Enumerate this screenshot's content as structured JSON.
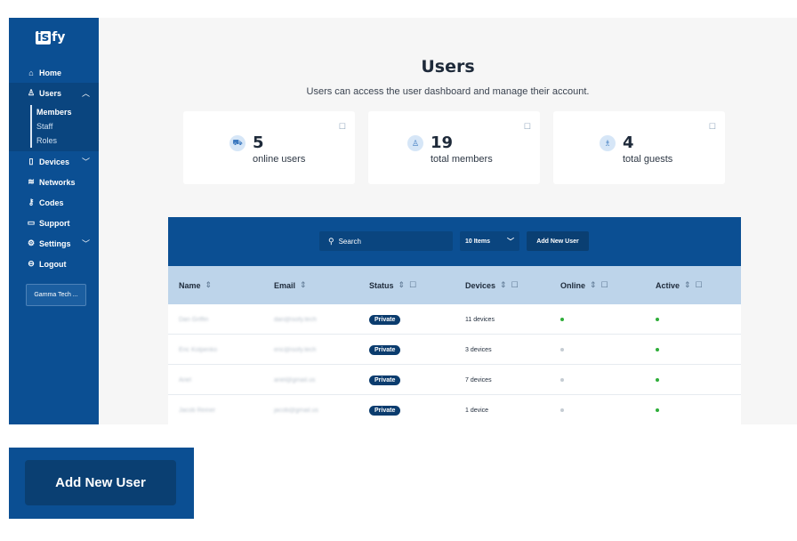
{
  "brand": {
    "logo_left": "is",
    "logo_right": "fy"
  },
  "sidebar": {
    "items": [
      {
        "label": "Home",
        "icon": "home-icon"
      },
      {
        "label": "Users",
        "icon": "user-icon",
        "expanded": true
      },
      {
        "label": "Devices",
        "icon": "device-icon"
      },
      {
        "label": "Networks",
        "icon": "wifi-icon"
      },
      {
        "label": "Codes",
        "icon": "key-icon"
      },
      {
        "label": "Support",
        "icon": "ticket-icon"
      },
      {
        "label": "Settings",
        "icon": "gear-icon"
      },
      {
        "label": "Logout",
        "icon": "logout-icon"
      }
    ],
    "users_sub": [
      "Members",
      "Staff",
      "Roles"
    ],
    "active_sub": "Members",
    "tenant": "Gamma Tech ..."
  },
  "header": {
    "title": "Users",
    "subtitle": "Users can access the user dashboard and manage their account."
  },
  "stats": [
    {
      "value": "5",
      "label": "online users",
      "icon": "car-icon"
    },
    {
      "value": "19",
      "label": "total members",
      "icon": "user-icon"
    },
    {
      "value": "4",
      "label": "total guests",
      "icon": "guest-icon"
    }
  ],
  "toolbar": {
    "search_placeholder": "Search",
    "per_page": "10 Items",
    "add_label": "Add New User"
  },
  "table": {
    "columns": [
      "Name",
      "Email",
      "Status",
      "Devices",
      "Online",
      "Active"
    ],
    "rows": [
      {
        "name": "Dan Griffin",
        "email": "dan@isofy.tech",
        "status": "Private",
        "devices": "11 devices",
        "online": true,
        "active": true
      },
      {
        "name": "Eric Kolpenko",
        "email": "eric@isofy.tech",
        "status": "Private",
        "devices": "3 devices",
        "online": false,
        "active": true
      },
      {
        "name": "Ariel",
        "email": "ariel@gmail.us",
        "status": "Private",
        "devices": "7 devices",
        "online": false,
        "active": true
      },
      {
        "name": "Jacob Reiner",
        "email": "jacob@gmail.us",
        "status": "Private",
        "devices": "1 device",
        "online": false,
        "active": true
      }
    ]
  },
  "zoom": {
    "label": "Add New User"
  },
  "colors": {
    "primary": "#0b4f93",
    "header_row": "#bdd4ea",
    "online": "#2fae3a"
  }
}
